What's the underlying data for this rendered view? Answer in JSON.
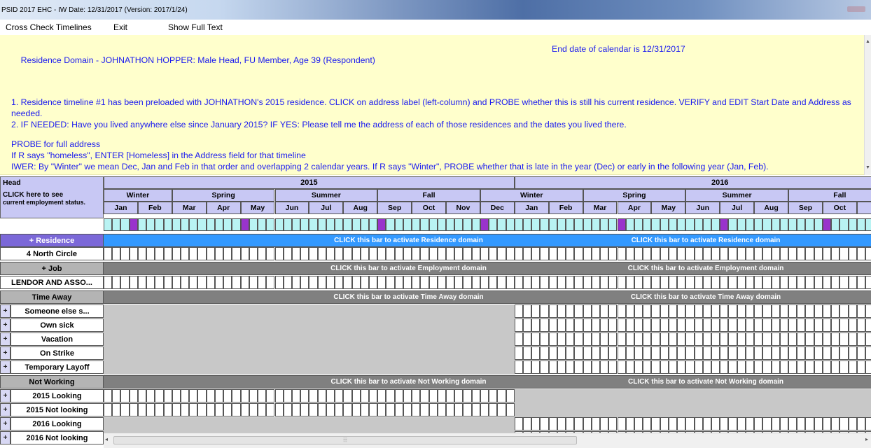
{
  "window": {
    "title": "PSID 2017 EHC - IW Date: 12/31/2017 (Version: 2017/1/24)"
  },
  "menu": {
    "items": [
      "Cross Check Timelines",
      "Exit",
      "Show Full Text"
    ]
  },
  "instructions": {
    "domain_line": "Residence Domain - JOHNATHON HOPPER: Male Head, FU Member, Age 39 (Respondent)",
    "end_date": "End date of calendar is 12/31/2017",
    "item1": "1. Residence timeline #1 has been preloaded with JOHNATHON's 2015 residence. CLICK on address label (left-column) and PROBE whether this is still his current residence. VERIFY and EDIT Start Date and Address as needed.",
    "item2": "2. IF NEEDED: Have you lived anywhere else since January 2015? IF YES: Please tell me the address of each of those residences and the dates you lived there.",
    "probe1": "PROBE for full address",
    "probe2": "If R says \"homeless\", ENTER [Homeless] in the Address field for that timeline",
    "iwer": "IWER: By \"Winter\" we mean Dec, Jan and Feb in that order and overlapping 2 calendar years. If R says \"Winter\", PROBE whether that is late in the year (Dec) or early in the following year (Jan, Feb)."
  },
  "grid_header": {
    "head_label": "Head",
    "click_label": "CLICK here to see",
    "status_label": "current employment status.",
    "years": [
      "2015",
      "2016"
    ],
    "seasons": [
      "Winter",
      "Spring",
      "Summer",
      "Fall",
      "Winter",
      "Spring",
      "Summer",
      "Fall"
    ],
    "months": [
      "Jan",
      "Feb",
      "Mar",
      "Apr",
      "May",
      "Jun",
      "Jul",
      "Aug",
      "Sep",
      "Oct",
      "Nov",
      "Dec",
      "Jan",
      "Feb",
      "Mar",
      "Apr",
      "May",
      "Jun",
      "Jul",
      "Aug",
      "Sep",
      "Oct",
      "N"
    ]
  },
  "rows": {
    "residence_header": "+ Residence",
    "residence_item": "4 North Circle",
    "job_header": "+ Job",
    "job_item": "LENDOR AND ASSO...",
    "time_away_header": "Time Away",
    "time_away_items": [
      "Someone else s...",
      "Own sick",
      "Vacation",
      "On Strike",
      "Temporary Layoff"
    ],
    "not_working_header": "Not Working",
    "not_working_items": [
      "2015 Looking",
      "2015 Not looking",
      "2016 Looking",
      "2016 Not looking"
    ],
    "plus_symbol": "+"
  },
  "bars": {
    "residence": "CLICK this bar to activate Residence domain",
    "employment": "CLICK this bar to activate Employment domain",
    "time_away": "CLICK this bar to activate Time Away domain",
    "not_working": "CLICK this bar to activate Not Working domain"
  },
  "colors": {
    "instruction_bg": "#ffffcc",
    "instruction_text": "#1a1af0",
    "header_lavender": "#c8c8f4",
    "residence_bar": "#3399ff",
    "residence_label": "#7b68d8",
    "gray_bar": "#808080",
    "week_cyan": "#b9f3f3",
    "week_purple": "#9933cc",
    "inactive_grey": "#c8c8c8"
  }
}
